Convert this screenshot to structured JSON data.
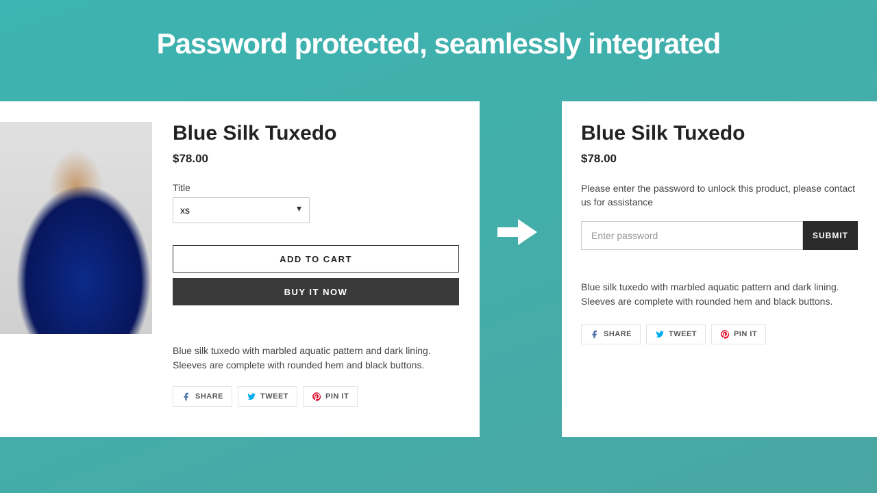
{
  "headline": "Password protected, seamlessly integrated",
  "left": {
    "title": "Blue Silk Tuxedo",
    "price": "$78.00",
    "size_label": "Title",
    "size_value": "xs",
    "add_to_cart": "ADD TO CART",
    "buy_now": "BUY IT NOW",
    "description": "Blue silk tuxedo with marbled aquatic pattern and dark lining. Sleeves are complete with rounded hem and black buttons.",
    "share": {
      "fb": "SHARE",
      "tw": "TWEET",
      "pin": "PIN IT"
    }
  },
  "right": {
    "title": "Blue Silk Tuxedo",
    "price": "$78.00",
    "prompt": "Please enter the password to unlock this product, please contact us for assistance",
    "placeholder": "Enter password",
    "submit": "SUBMIT",
    "description": "Blue silk tuxedo with marbled aquatic pattern and dark lining. Sleeves are complete with rounded hem and black buttons.",
    "share": {
      "fb": "SHARE",
      "tw": "TWEET",
      "pin": "PIN IT"
    }
  }
}
